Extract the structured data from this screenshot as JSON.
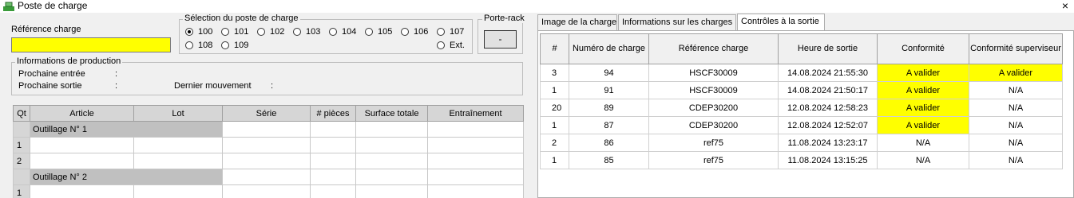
{
  "window": {
    "title": "Poste de charge",
    "close": "×"
  },
  "colors": {
    "highlight": "#ffff00",
    "panel": "#f0f0f0"
  },
  "ref_charge": {
    "label": "Référence charge",
    "value": ""
  },
  "station": {
    "title": "Sélection du poste de charge",
    "options": [
      "100",
      "101",
      "102",
      "103",
      "104",
      "105",
      "106",
      "107",
      "108",
      "109",
      "Ext."
    ],
    "selected": "100"
  },
  "porte_rack": {
    "label": "Porte-rack",
    "button": "-"
  },
  "production": {
    "title": "Informations de production",
    "next_in_label": "Prochaine entrée",
    "next_in_sep": ":",
    "next_out_label": "Prochaine sortie",
    "next_out_sep": ":",
    "last_move_label": "Dernier mouvement",
    "last_move_sep": ":"
  },
  "grid": {
    "headers": [
      "Qt",
      "Article",
      "Lot",
      "Série",
      "# pièces",
      "Surface totale",
      "Entraînement"
    ],
    "outil1": "Outillage N° 1",
    "outil2": "Outillage N° 2",
    "rows": [
      "1",
      "2",
      "1"
    ]
  },
  "tabs": [
    "Image de la charge",
    "Informations sur les charges",
    "Contrôles à la sortie"
  ],
  "active_tab": 2,
  "results": {
    "headers": [
      "#",
      "Numéro de charge",
      "Référence charge",
      "Heure de sortie",
      "Conformité",
      "Conformité superviseur"
    ],
    "rows": [
      {
        "n": "3",
        "num": "94",
        "ref": "HSCF30009",
        "heure": "14.08.2024 21:55:30",
        "conf": "A valider",
        "sup": "A valider"
      },
      {
        "n": "1",
        "num": "91",
        "ref": "HSCF30009",
        "heure": "14.08.2024 21:50:17",
        "conf": "A valider",
        "sup": "N/A"
      },
      {
        "n": "20",
        "num": "89",
        "ref": "CDEP30200",
        "heure": "12.08.2024 12:58:23",
        "conf": "A valider",
        "sup": "N/A"
      },
      {
        "n": "1",
        "num": "87",
        "ref": "CDEP30200",
        "heure": "12.08.2024 12:52:07",
        "conf": "A valider",
        "sup": "N/A"
      },
      {
        "n": "2",
        "num": "86",
        "ref": "ref75",
        "heure": "11.08.2024 13:23:17",
        "conf": "N/A",
        "sup": "N/A"
      },
      {
        "n": "1",
        "num": "85",
        "ref": "ref75",
        "heure": "11.08.2024 13:15:25",
        "conf": "N/A",
        "sup": "N/A"
      }
    ]
  }
}
